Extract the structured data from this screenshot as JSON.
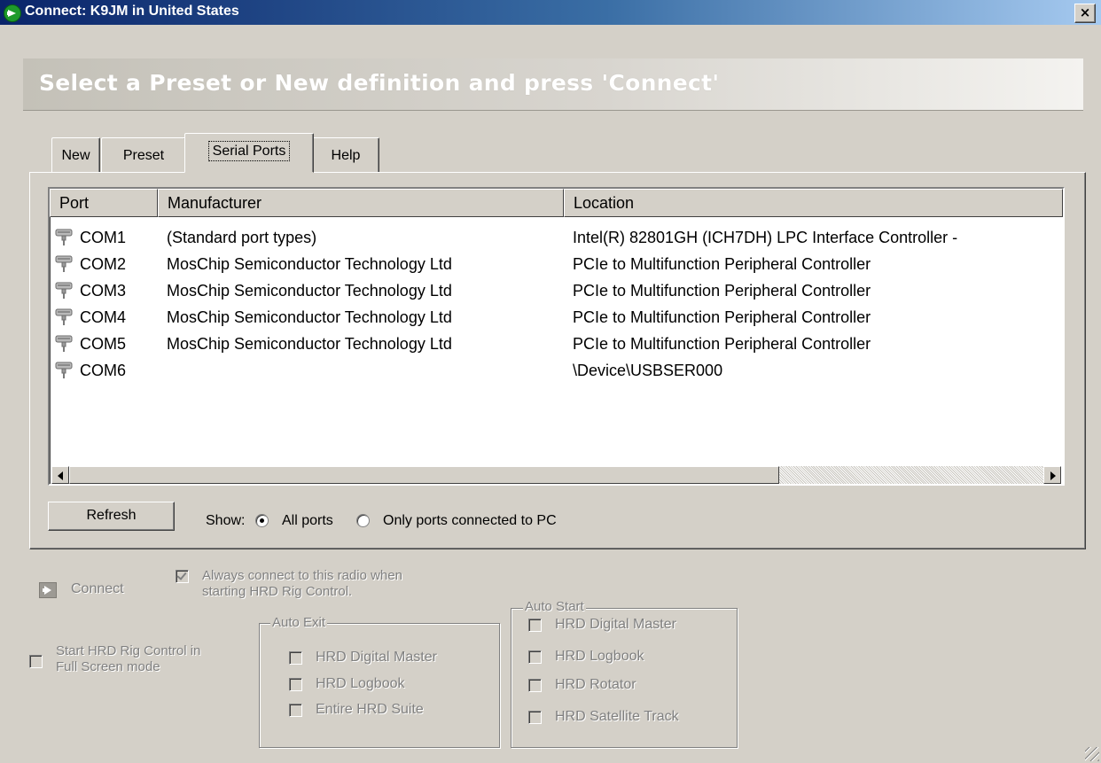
{
  "window": {
    "title": "Connect: K9JM in United States",
    "close_label": "×",
    "title_icon": "green-arrow-right-icon"
  },
  "banner": {
    "text": "Select a Preset or New definition and press 'Connect'"
  },
  "tabs": [
    {
      "label": "New"
    },
    {
      "label": "Preset"
    },
    {
      "label": "Serial Ports",
      "active": true
    },
    {
      "label": "Help"
    }
  ],
  "ports_table": {
    "columns": [
      "Port",
      "Manufacturer",
      "Location"
    ],
    "rows": [
      {
        "port": "COM1",
        "manufacturer": "(Standard port types)",
        "location": "Intel(R) 82801GH (ICH7DH) LPC Interface Controller -"
      },
      {
        "port": "COM2",
        "manufacturer": "MosChip Semiconductor Technology Ltd",
        "location": "PCIe to Multifunction Peripheral Controller"
      },
      {
        "port": "COM3",
        "manufacturer": "MosChip Semiconductor Technology Ltd",
        "location": "PCIe to Multifunction Peripheral Controller"
      },
      {
        "port": "COM4",
        "manufacturer": "MosChip Semiconductor Technology Ltd",
        "location": "PCIe to Multifunction Peripheral Controller"
      },
      {
        "port": "COM5",
        "manufacturer": "MosChip Semiconductor Technology Ltd",
        "location": "PCIe to Multifunction Peripheral Controller"
      },
      {
        "port": "COM6",
        "manufacturer": "",
        "location": "\\Device\\USBSER000"
      }
    ],
    "row_icon": "serial-port-icon"
  },
  "controls": {
    "refresh_label": "Refresh",
    "show_label": "Show:",
    "all_ports_label": "All ports",
    "only_connected_label": "Only ports connected to PC",
    "selected_option": "All ports"
  },
  "connect": {
    "button_label": "Connect",
    "always_connect_line1": "Always connect to this radio when",
    "always_connect_line2": "starting HRD Rig Control.",
    "always_connect_checked": true,
    "fullscreen_line1": "Start HRD Rig Control in",
    "fullscreen_line2": "Full Screen mode",
    "fullscreen_checked": false
  },
  "auto_exit": {
    "title": "Auto Exit",
    "items": [
      "HRD Digital Master",
      "HRD Logbook",
      "Entire HRD Suite"
    ]
  },
  "auto_start": {
    "title": "Auto Start",
    "items": [
      "HRD Digital Master",
      "HRD Logbook",
      "HRD Rotator",
      "HRD Satellite Track"
    ]
  },
  "colors": {
    "title_bar_start": "#0a246a",
    "title_bar_end": "#a6caf0",
    "dialog_face": "#d4d0c8",
    "disabled_text": "#808080"
  }
}
